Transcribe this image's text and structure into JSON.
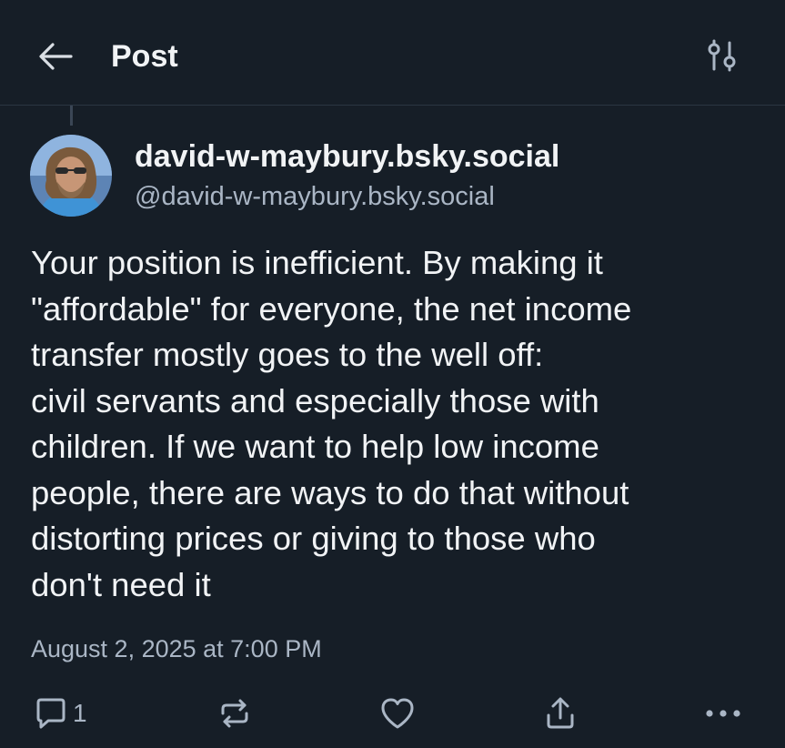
{
  "header": {
    "title": "Post",
    "back_icon": "arrow-left-icon",
    "filter_icon": "sliders-icon"
  },
  "author": {
    "display_name": "david-w-maybury.bsky.social",
    "handle": "@david-w-maybury.bsky.social"
  },
  "post": {
    "lines": [
      "Your position is inefficient. By making it",
      "\"affordable\" for everyone, the net income",
      "transfer mostly goes to the well off:",
      "civil servants and especially those with",
      "children. If we want to help low income",
      "people, there are ways to do that without",
      "distorting prices or giving to those who",
      "don't need it"
    ],
    "timestamp": "August 2, 2025 at 7:00 PM"
  },
  "actions": {
    "reply_count": "1",
    "icons": [
      "reply-icon",
      "repost-icon",
      "like-icon",
      "share-icon",
      "more-icon"
    ]
  },
  "colors": {
    "background": "#161e27",
    "text": "#f1f3f5",
    "muted": "#aab6c5",
    "divider": "#2b3542"
  }
}
